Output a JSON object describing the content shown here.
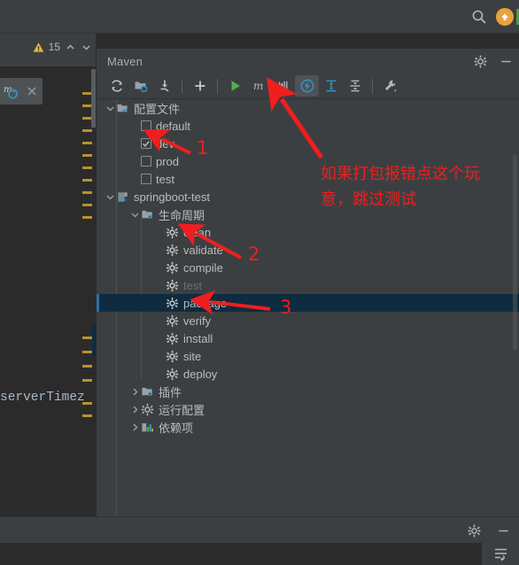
{
  "topbar": {
    "search_icon": "search-icon",
    "update_icon": "update-arrow-icon"
  },
  "editor": {
    "warning_count": "15",
    "warning_icon": "warning-triangle-icon",
    "prev_icon": "chevron-up-icon",
    "next_icon": "chevron-down-icon",
    "tab_icon": "maven-refresh-icon",
    "tab_close_icon": "close-icon",
    "code_fragment": "serverTimez"
  },
  "maven": {
    "title": "Maven",
    "settings_icon": "gear-icon",
    "minimize_icon": "minimize-icon",
    "toolbar": [
      {
        "name": "reload-all-maven-projects-button",
        "icon": "refresh-icon"
      },
      {
        "name": "add-maven-project-button",
        "icon": "folder-add-icon"
      },
      {
        "name": "download-sources-button",
        "icon": "download-icon"
      },
      {
        "name": "add-button",
        "icon": "plus-icon"
      },
      {
        "name": "run-button",
        "icon": "run-triangle-icon"
      },
      {
        "name": "execute-maven-goal-button",
        "icon": "maven-m-icon"
      },
      {
        "name": "toggle-offline-mode-button",
        "icon": "offline-icon"
      },
      {
        "name": "skip-tests-button",
        "icon": "lightning-icon"
      },
      {
        "name": "expand-all-button",
        "icon": "expand-all-icon"
      },
      {
        "name": "collapse-all-button",
        "icon": "collapse-all-icon"
      },
      {
        "name": "maven-settings-button",
        "icon": "wrench-icon"
      }
    ],
    "tree": [
      {
        "label": "配置文件",
        "icon": "profiles-folder-icon",
        "indent": 0,
        "toggle": "expanded",
        "kind": "node"
      },
      {
        "label": "default",
        "icon": "checkbox",
        "indent": 1,
        "checked": false,
        "kind": "check"
      },
      {
        "label": "dev",
        "icon": "checkbox",
        "indent": 1,
        "checked": true,
        "kind": "check"
      },
      {
        "label": "prod",
        "icon": "checkbox",
        "indent": 1,
        "checked": false,
        "kind": "check"
      },
      {
        "label": "test",
        "icon": "checkbox",
        "indent": 1,
        "checked": false,
        "kind": "check"
      },
      {
        "label": "springboot-test",
        "icon": "maven-project-icon",
        "indent": 0,
        "toggle": "expanded",
        "kind": "node"
      },
      {
        "label": "生命周期",
        "icon": "lifecycle-folder-icon",
        "indent": 1,
        "toggle": "expanded",
        "kind": "node"
      },
      {
        "label": "clean",
        "icon": "goal-gear-icon",
        "indent": 2,
        "kind": "goal"
      },
      {
        "label": "validate",
        "icon": "goal-gear-icon",
        "indent": 2,
        "kind": "goal"
      },
      {
        "label": "compile",
        "icon": "goal-gear-icon",
        "indent": 2,
        "kind": "goal"
      },
      {
        "label": "test",
        "icon": "goal-gear-icon",
        "indent": 2,
        "kind": "goal",
        "dimmed": true
      },
      {
        "label": "package",
        "icon": "goal-gear-icon",
        "indent": 2,
        "kind": "goal",
        "selected": true
      },
      {
        "label": "verify",
        "icon": "goal-gear-icon",
        "indent": 2,
        "kind": "goal"
      },
      {
        "label": "install",
        "icon": "goal-gear-icon",
        "indent": 2,
        "kind": "goal"
      },
      {
        "label": "site",
        "icon": "goal-gear-icon",
        "indent": 2,
        "kind": "goal"
      },
      {
        "label": "deploy",
        "icon": "goal-gear-icon",
        "indent": 2,
        "kind": "goal"
      },
      {
        "label": "插件",
        "icon": "plugins-folder-icon",
        "indent": 1,
        "toggle": "collapsed",
        "kind": "node"
      },
      {
        "label": "运行配置",
        "icon": "run-config-gear-icon",
        "indent": 1,
        "toggle": "collapsed",
        "kind": "node"
      },
      {
        "label": "依赖项",
        "icon": "dependencies-icon",
        "indent": 1,
        "toggle": "collapsed",
        "kind": "node"
      }
    ]
  },
  "annotations": {
    "note_line1": "如果打包报错点这个玩",
    "note_line2": "意，跳过测试",
    "marker_1": "1",
    "marker_2": "2",
    "marker_3": "3",
    "color": "#f01e1e"
  },
  "status": {
    "settings_icon": "gear-icon",
    "minimize_icon": "minimize-icon",
    "soft_wrap_icon": "soft-wrap-icon"
  }
}
